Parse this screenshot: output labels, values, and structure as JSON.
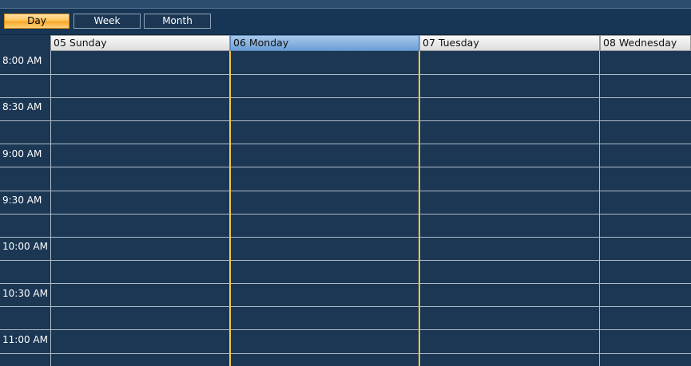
{
  "views": [
    {
      "label": "Day",
      "active": true
    },
    {
      "label": "Week",
      "active": false
    },
    {
      "label": "Month",
      "active": false
    }
  ],
  "days": [
    {
      "label": "05 Sunday",
      "today": false
    },
    {
      "label": "06 Monday",
      "today": true
    },
    {
      "label": "07 Tuesday",
      "today": false
    },
    {
      "label": "08 Wednesday",
      "today": false
    }
  ],
  "times": [
    "8:00 AM",
    "8:30 AM",
    "9:00 AM",
    "9:30 AM",
    "10:00 AM",
    "10:30 AM",
    "11:00 AM"
  ],
  "colors": {
    "background": "#1b3753",
    "today_line": "#f5c542",
    "active_view": "#ffc35a"
  }
}
